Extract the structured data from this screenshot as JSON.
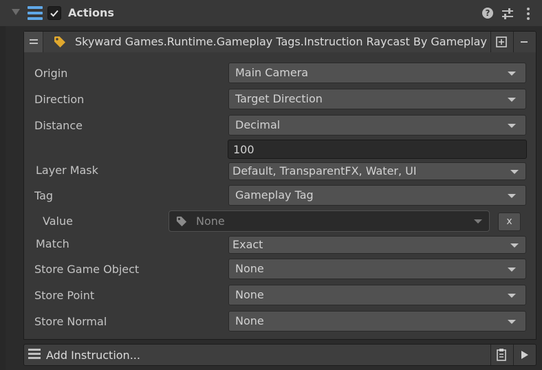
{
  "header": {
    "title": "Actions",
    "help_icon": "help-circle-icon",
    "settings_icon": "sliders-icon",
    "menu_icon": "kebab-icon"
  },
  "instruction": {
    "title": "Skyward Games.Runtime.Gameplay Tags.Instruction Raycast By Gameplay Tag",
    "icon": "tag-icon",
    "expand_label": "⊞",
    "remove_label": "−"
  },
  "fields": {
    "origin": {
      "label": "Origin",
      "value": "Main Camera"
    },
    "direction": {
      "label": "Direction",
      "value": "Target Direction"
    },
    "distance": {
      "label": "Distance",
      "value": "Decimal",
      "number": "100"
    },
    "layer_mask": {
      "label": "Layer Mask",
      "value": "Default, TransparentFX, Water, UI"
    },
    "tag": {
      "label": "Tag",
      "value": "Gameplay Tag"
    },
    "tag_value": {
      "label": "Value",
      "value": "None",
      "clear_label": "x"
    },
    "match": {
      "label": "Match",
      "value": "Exact"
    },
    "store_game_object": {
      "label": "Store Game Object",
      "value": "None"
    },
    "store_point": {
      "label": "Store Point",
      "value": "None"
    },
    "store_normal": {
      "label": "Store Normal",
      "value": "None"
    }
  },
  "footer": {
    "add_label": "Add Instruction...",
    "paste_icon": "clipboard-icon",
    "play_icon": "play-icon"
  },
  "colors": {
    "accent_blue": "#5fa8e8",
    "tag_gold": "#e0a82e",
    "panel": "#383838",
    "field": "#515151"
  }
}
